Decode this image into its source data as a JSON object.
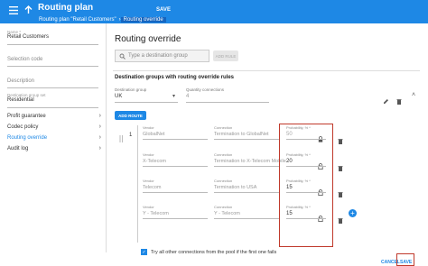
{
  "header": {
    "title": "Routing plan",
    "save_label": "SAVE",
    "breadcrumbs": [
      "Routing plan \"Retail Customers\"",
      "Routing override"
    ]
  },
  "sidebar": {
    "name_label": "Name *",
    "name_value": "Retail Customers",
    "selection_code_placeholder": "Selection code",
    "description_placeholder": "Description",
    "dest_group_set_label": "Destination group set",
    "dest_group_set_value": "Residential",
    "items": [
      {
        "label": "Profit guarantee"
      },
      {
        "label": "Codec policy"
      },
      {
        "label": "Routing override"
      },
      {
        "label": "Audit log"
      }
    ]
  },
  "main": {
    "title": "Routing override",
    "search_placeholder": "Type a destination group",
    "add_rule_label": "ADD RULE",
    "section_title": "Destination groups with routing override rules",
    "dest_group_label": "Destination group",
    "dest_group_value": "UK",
    "quantity_label": "Quantity connections",
    "quantity_value": "4",
    "add_route_label": "ADD ROUTE",
    "route_index": "1",
    "vendor_label": "Vendor",
    "connection_label": "Connection",
    "probability_label": "Probability, % *",
    "rows": [
      {
        "vendor": "GlobalNet",
        "connection": "Termination to GlobalNet",
        "probability": "50"
      },
      {
        "vendor": "X-Telecom",
        "connection": "Termination to X-Telecom Mobile",
        "probability": "20"
      },
      {
        "vendor": "Telecom",
        "connection": "Termination to USA",
        "probability": "15"
      },
      {
        "vendor": "Y - Telecom",
        "connection": "Y - Telecom",
        "probability": "15"
      }
    ],
    "checkbox_label": "Try all other connections from the pool if the first one fails",
    "cancel_label": "CANCEL",
    "save_label": "SAVE"
  },
  "colors": {
    "accent": "#1e88e5",
    "highlight": "#c0392b"
  }
}
